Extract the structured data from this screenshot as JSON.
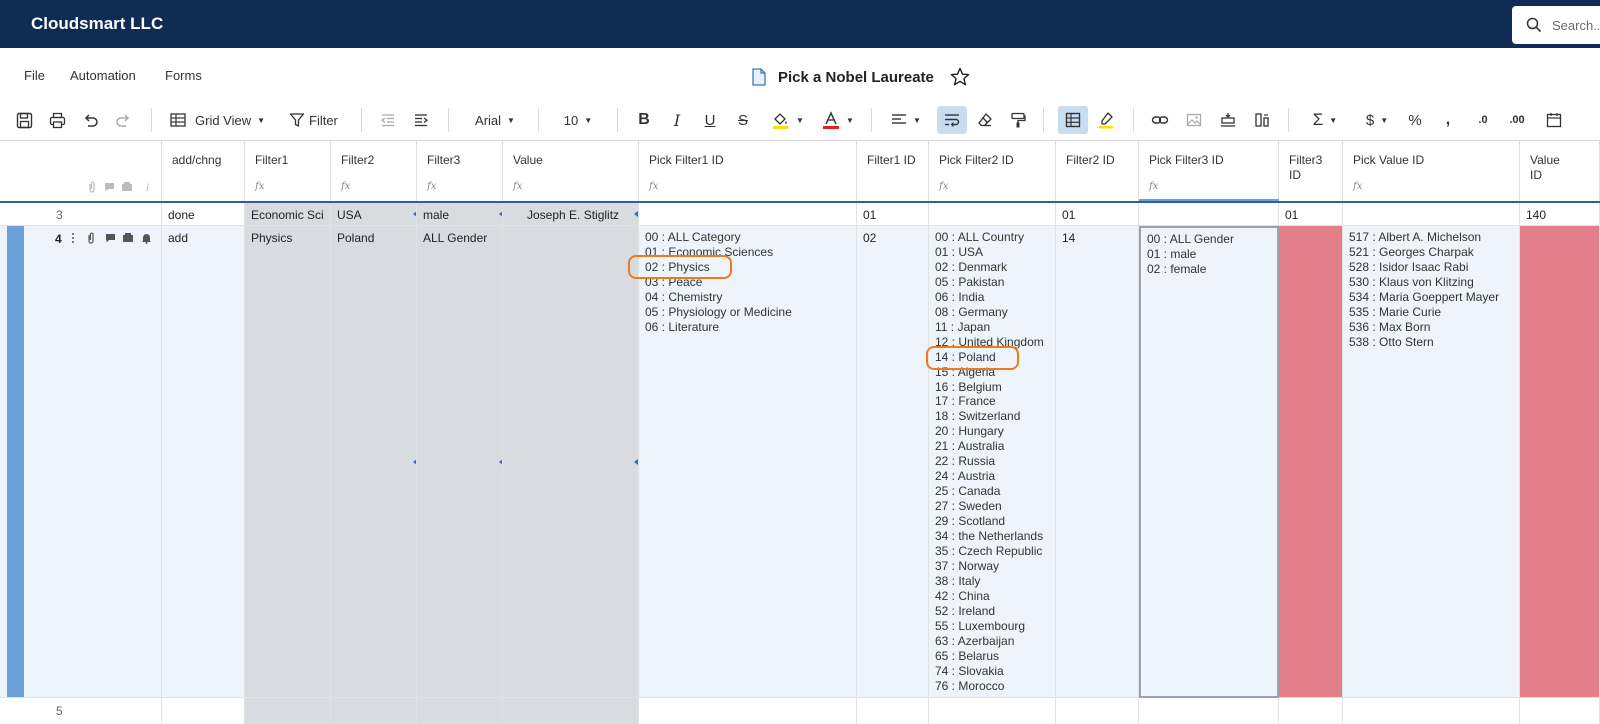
{
  "app": {
    "company": "Cloudsmart LLC",
    "search_placeholder": "Search..."
  },
  "menu": {
    "file": "File",
    "automation": "Automation",
    "forms": "Forms"
  },
  "sheet": {
    "title": "Pick a Nobel Laureate"
  },
  "toolbar": {
    "view_label": "Grid View",
    "filter_label": "Filter",
    "font": "Arial",
    "font_size": "10"
  },
  "columns": {
    "add_chng": "add/chng",
    "filter1": "Filter1",
    "filter2": "Filter2",
    "filter3": "Filter3",
    "value": "Value",
    "pick_filter1_id": "Pick Filter1 ID",
    "filter1_id": "Filter1 ID",
    "pick_filter2_id": "Pick Filter2 ID",
    "filter2_id": "Filter2 ID",
    "pick_filter3_id": "Pick Filter3 ID",
    "filter3_id": "Filter3\nID",
    "pick_value_id": "Pick Value ID",
    "value_id": "Value\nID",
    "fx": "fx"
  },
  "rows": {
    "r3": {
      "num": "3",
      "add_chng": "done",
      "filter1": "Economic Sci",
      "filter2": "USA",
      "filter3": "male",
      "value": "Joseph E. Stiglitz",
      "filter1_id": "01",
      "filter2_id": "01",
      "filter3_id": "01",
      "value_id": "140"
    },
    "r4": {
      "num": "4",
      "add_chng": "add",
      "filter1": "Physics",
      "filter2": "Poland",
      "filter3": "ALL Gender",
      "filter1_id": "02",
      "filter2_id": "14",
      "pick_filter1": "00 : ALL Category\n01 : Economic Sciences\n02 : Physics\n03 : Peace\n04 : Chemistry\n05 : Physiology or Medicine\n06 : Literature",
      "pick_filter2": "00 : ALL Country\n01 : USA\n02 : Denmark\n05 : Pakistan\n06 : India\n08 : Germany\n11 : Japan\n12 : United Kingdom\n14 : Poland\n15 : Algeria\n16 : Belgium\n17 : France\n18 : Switzerland\n20 : Hungary\n21 : Australia\n22 : Russia\n24 : Austria\n25 : Canada\n27 : Sweden\n29 : Scotland\n34 : the Netherlands\n35 : Czech Republic\n37 : Norway\n38 : Italy\n42 : China\n52 : Ireland\n55 : Luxembourg\n63 : Azerbaijan\n65 : Belarus\n74 : Slovakia\n76 : Morocco",
      "pick_filter3": "00 : ALL Gender\n01 : male\n02 : female",
      "pick_value": "517 : Albert A. Michelson\n521 : Georges Charpak\n528 : Isidor Isaac Rabi\n530 : Klaus von Klitzing\n534 : Maria Goeppert Mayer\n535 : Marie Curie\n536 : Max Born\n538 : Otto Stern"
    },
    "r5": {
      "num": "5"
    }
  },
  "colors": {
    "topbar": "#0f2d54",
    "highlight": "#f07a1a",
    "error_cell": "#e27f89",
    "row_marker": "#6a9fd8"
  }
}
